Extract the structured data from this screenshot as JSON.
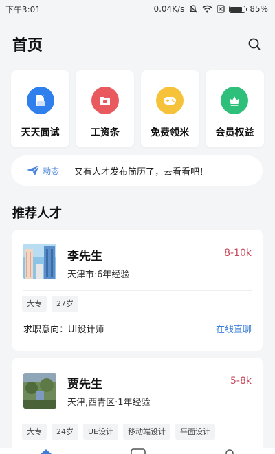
{
  "status_bar": {
    "time": "下午3:01",
    "speed": "0.04K/s",
    "battery": "85%",
    "battery_level": 0.85
  },
  "header": {
    "title": "首页"
  },
  "quick_actions": [
    {
      "label": "天天面试",
      "icon": "interview-icon",
      "color": "#2f80ed"
    },
    {
      "label": "工资条",
      "icon": "salary-slip-icon",
      "color": "#e85a5e"
    },
    {
      "label": "免费领米",
      "icon": "gamepad-icon",
      "color": "#f5c23a"
    },
    {
      "label": "会员权益",
      "icon": "crown-icon",
      "color": "#2ec07a"
    }
  ],
  "news": {
    "tag": "动态",
    "text": "又有人才发布简历了，去看看吧！"
  },
  "section": {
    "title": "推荐人才"
  },
  "talents": [
    {
      "name": "李先生",
      "salary": "8-10k",
      "meta": "天津市·6年经验",
      "tags": [
        "大专",
        "27岁"
      ],
      "intent": "求职意向：UI设计师",
      "action": "在线直聊"
    },
    {
      "name": "贾先生",
      "salary": "5-8k",
      "meta": "天津,西青区·1年经验",
      "tags": [
        "大专",
        "24岁",
        "UE设计",
        "移动端设计",
        "平面设计"
      ]
    }
  ]
}
